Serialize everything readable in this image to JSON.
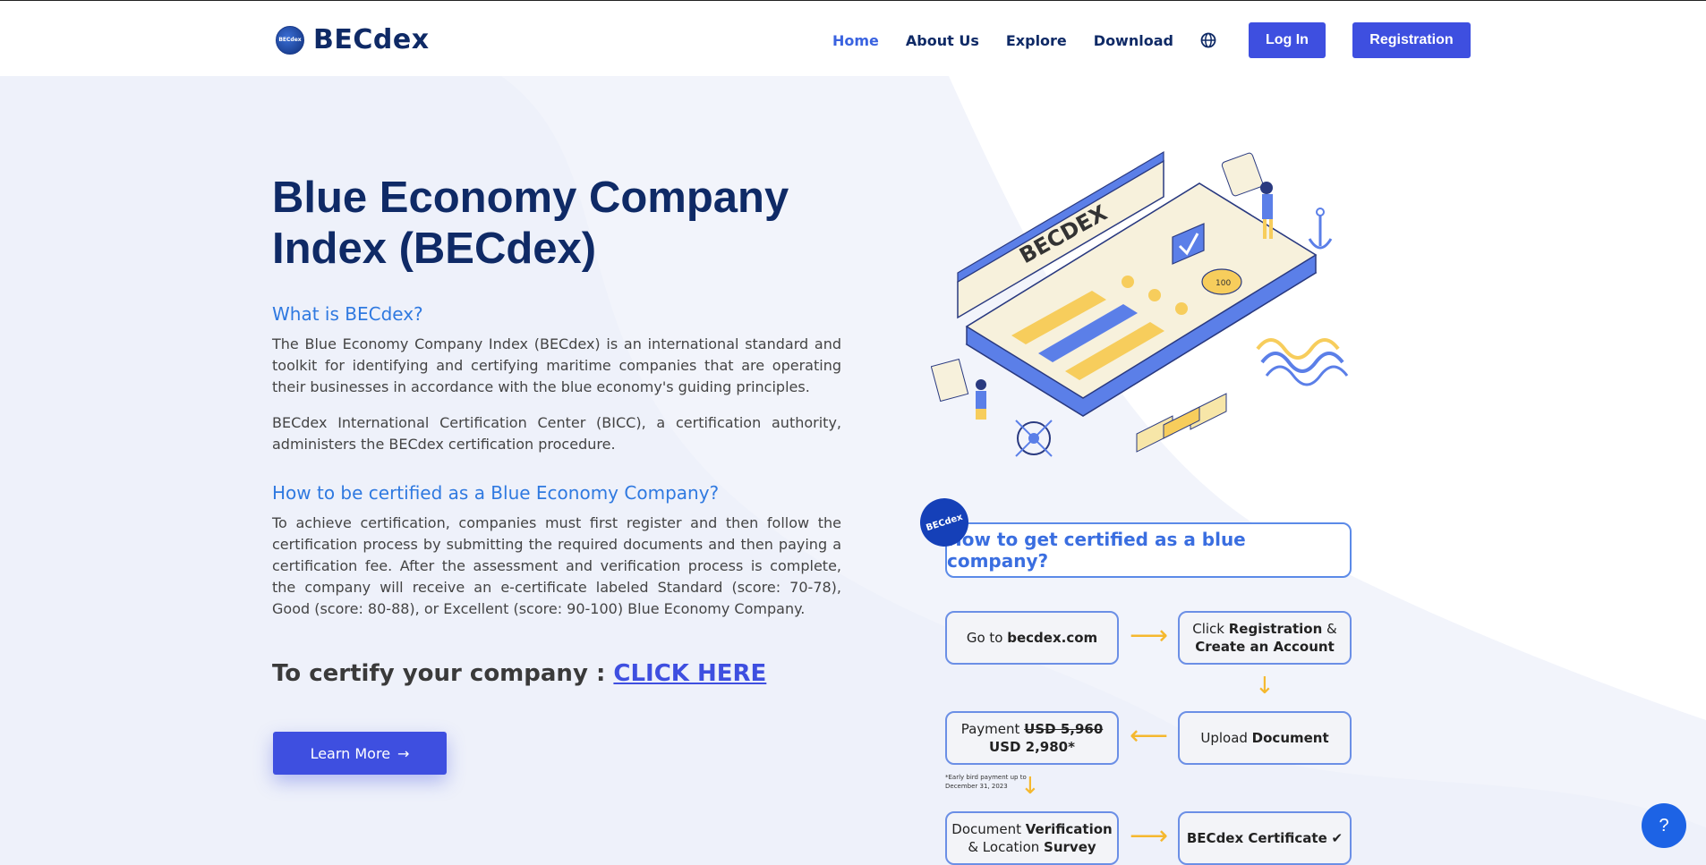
{
  "header": {
    "brand": "BECdex",
    "logo_badge_text": "BECdex",
    "nav": [
      {
        "label": "Home",
        "active": true
      },
      {
        "label": "About Us",
        "active": false
      },
      {
        "label": "Explore",
        "active": false
      },
      {
        "label": "Download",
        "active": false
      }
    ],
    "language_icon": "globe-icon",
    "login_label": "Log In",
    "register_label": "Registration"
  },
  "hero": {
    "title_line1": "Blue Economy Company",
    "title_line2": "Index (BECdex)",
    "what_heading": "What is BECdex?",
    "what_p1": "The Blue Economy Company Index (BECdex) is an international standard and toolkit for identifying and certifying maritime companies that are operating their businesses in accordance with the blue economy's guiding principles.",
    "what_p2": "BECdex International Certification Center (BICC), a certification authority, administers the BECdex certification procedure.",
    "how_heading": "How to be certified as a Blue Economy Company?",
    "how_p": "To achieve certification, companies must first register and then follow the certification process by submitting the required documents and then paying a certification fee. After the assessment and verification process is complete, the company will receive an e-certificate labeled Standard (score: 70-78), Good (score: 80-88), or Excellent (score: 90-100) Blue Economy Company.",
    "certify_prefix": "To certify your company : ",
    "certify_link": "CLICK HERE",
    "learn_more": "Learn More"
  },
  "illustration": {
    "board_label": "BECDEX",
    "coin_label": "100"
  },
  "flow": {
    "badge": "BECdex",
    "title": "How to get certified as a blue company?",
    "step1_pre": "Go to ",
    "step1_bold": "becdex.com",
    "step2_pre": "Click ",
    "step2_bold1": "Registration",
    "step2_mid": " & ",
    "step2_bold2": "Create an Account",
    "step3_pre": "Upload ",
    "step3_bold": "Document",
    "step4_pre": "Payment ",
    "step4_strike": "USD 5,960",
    "step4_price": "USD 2,980*",
    "step4_note": "*Early bird payment up to December 31, 2023",
    "step5_pre": "Document ",
    "step5_bold1": "Verification",
    "step5_mid": "& Location ",
    "step5_bold2": "Survey",
    "step6_bold": "BECdex Certificate",
    "step6_icon": "✔"
  },
  "help": {
    "label": "?"
  },
  "colors": {
    "primary": "#3e4fe0",
    "navy": "#0f2a66",
    "accent_blue": "#2f79e0",
    "arrow": "#f5b82e"
  }
}
